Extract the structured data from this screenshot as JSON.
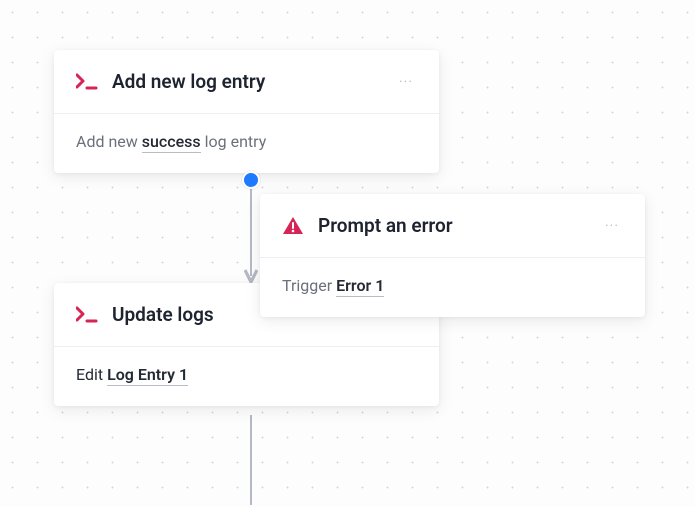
{
  "nodes": {
    "add_log": {
      "title": "Add new log entry",
      "body_prefix": "Add new ",
      "body_emph": "success",
      "body_suffix": " log entry"
    },
    "update_logs": {
      "title": "Update logs",
      "body_prefix": "Edit ",
      "body_emph": "Log Entry 1",
      "body_suffix": ""
    },
    "prompt_error": {
      "title": "Prompt an error",
      "body_prefix": "Trigger ",
      "body_emph": "Error 1",
      "body_suffix": ""
    }
  },
  "menu_glyph": "···"
}
